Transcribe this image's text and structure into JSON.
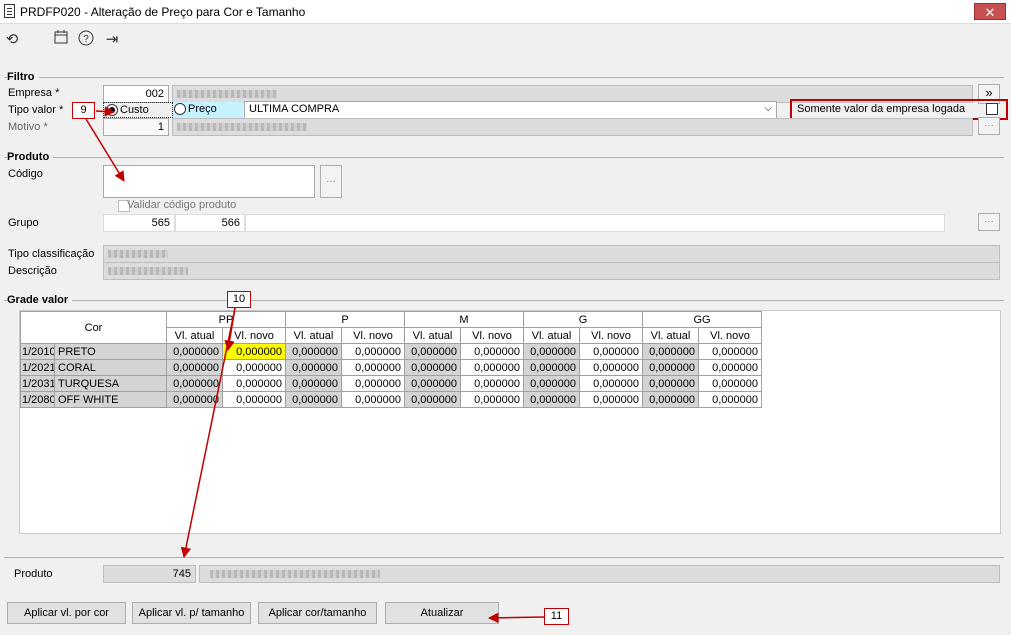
{
  "window": {
    "title": "PRDFP020 - Alteração de Preço para Cor e Tamanho",
    "close": "✕"
  },
  "toolbar": {
    "refresh": "⟲",
    "calendar": "📅",
    "help": "?",
    "exit": "⇥"
  },
  "filtro": {
    "section": "Filtro",
    "empresa_label": "Empresa *",
    "empresa_value": "002",
    "tipo_label": "Tipo valor *",
    "custo_label": "Custo",
    "preco_label": "Preço",
    "tipo_select": "ULTIMA COMPRA",
    "somente_label": "Somente valor da empresa logada",
    "motivo_label": "Motivo *",
    "motivo_value": "1",
    "more_btn": "»",
    "dots": "···"
  },
  "produto": {
    "section": "Produto",
    "codigo_label": "Código",
    "validar_label": "Validar código produto",
    "grupo_label": "Grupo",
    "grupo_v1": "565",
    "grupo_v2": "566",
    "tipo_class_label": "Tipo classificação",
    "descricao_label": "Descrição"
  },
  "grade": {
    "section": "Grade valor",
    "cor_header": "Cor",
    "sizes": [
      "PP",
      "P",
      "M",
      "G",
      "GG"
    ],
    "sub_atual": "Vl. atual",
    "sub_novo": "Vl. novo",
    "rows": [
      {
        "code": "1/2010",
        "name": "PRETO",
        "values": [
          "0,000000",
          "0,000000",
          "0,000000",
          "0,000000",
          "0,000000",
          "0,000000",
          "0,000000",
          "0,000000",
          "0,000000",
          "0,000000"
        ]
      },
      {
        "code": "1/2021",
        "name": "CORAL",
        "values": [
          "0,000000",
          "0,000000",
          "0,000000",
          "0,000000",
          "0,000000",
          "0,000000",
          "0,000000",
          "0,000000",
          "0,000000",
          "0,000000"
        ]
      },
      {
        "code": "1/2031",
        "name": "TURQUESA",
        "values": [
          "0,000000",
          "0,000000",
          "0,000000",
          "0,000000",
          "0,000000",
          "0,000000",
          "0,000000",
          "0,000000",
          "0,000000",
          "0,000000"
        ]
      },
      {
        "code": "1/2080",
        "name": "OFF WHITE",
        "values": [
          "0,000000",
          "0,000000",
          "0,000000",
          "0,000000",
          "0,000000",
          "0,000000",
          "0,000000",
          "0,000000",
          "0,000000",
          "0,000000"
        ]
      }
    ]
  },
  "footer": {
    "produto_label": "Produto",
    "produto_value": "745",
    "btn_aplicar_cor": "Aplicar vl. por cor",
    "btn_aplicar_tamanho": "Aplicar vl. p/ tamanho",
    "btn_aplicar_cor_tamanho": "Aplicar cor/tamanho",
    "btn_atualizar": "Atualizar"
  },
  "callouts": {
    "c9": "9",
    "c10": "10",
    "c11": "11"
  },
  "colors": {
    "annotation": "#c00000",
    "highlight": "#ffff00",
    "close": "#c75050"
  }
}
